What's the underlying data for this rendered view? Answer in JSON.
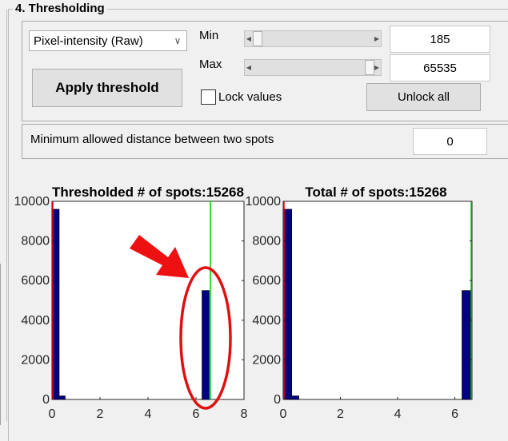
{
  "section": {
    "title": "4. Thresholding"
  },
  "controls": {
    "metric_dropdown": "Pixel-intensity (Raw)",
    "apply_button": "Apply threshold",
    "min_label": "Min",
    "max_label": "Max",
    "min_value": "185",
    "max_value": "65535",
    "min_slider_fraction": 0.003,
    "max_slider_fraction": 1.0,
    "lock_label": "Lock values",
    "lock_checked": false,
    "unlock_button": "Unlock all",
    "min_distance_label": "Minimum allowed distance between two spots",
    "min_distance_value": "0"
  },
  "chart_data": [
    {
      "type": "bar",
      "title": "Thresholded # of spots:15268",
      "x_ticks": [
        "0",
        "2",
        "4",
        "6",
        "8"
      ],
      "y_ticks": [
        "0",
        "2000",
        "4000",
        "6000",
        "8000",
        "10000"
      ],
      "xlim": [
        0,
        8
      ],
      "ylim": [
        0,
        10000
      ],
      "bars": [
        {
          "x": 0.15,
          "value": 9600
        },
        {
          "x": 0.4,
          "value": 180
        },
        {
          "x": 6.4,
          "value": 5500
        }
      ],
      "bar_width": 0.3,
      "bar_color": "#000080",
      "threshold_lines": [
        {
          "x": 0.0,
          "color": "#ff0000"
        },
        {
          "x": 6.6,
          "color": "#00cc00"
        }
      ],
      "annotation": {
        "arrow_color": "#ee1111",
        "ellipse_color": "#e01010"
      }
    },
    {
      "type": "bar",
      "title": "Total # of spots:15268",
      "x_ticks": [
        "0",
        "2",
        "4",
        "6"
      ],
      "y_ticks": [
        "0",
        "2000",
        "4000",
        "6000",
        "8000",
        "10000"
      ],
      "xlim": [
        0,
        6.6
      ],
      "ylim": [
        0,
        10000
      ],
      "bars": [
        {
          "x": 0.15,
          "value": 9600
        },
        {
          "x": 0.4,
          "value": 180
        },
        {
          "x": 6.4,
          "value": 5500
        }
      ],
      "bar_width": 0.3,
      "bar_color": "#000080",
      "threshold_lines": [
        {
          "x": 0.0,
          "color": "#ff0000"
        },
        {
          "x": 6.6,
          "color": "#00cc00"
        }
      ]
    }
  ]
}
